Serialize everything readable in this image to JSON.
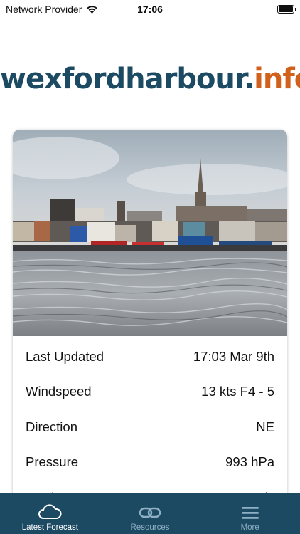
{
  "status": {
    "carrier": "Network Provider",
    "time": "17:06"
  },
  "logo": {
    "main": "wexfordharbour",
    "dot": ".",
    "ext": "info"
  },
  "weather": {
    "rows": [
      {
        "label": "Last Updated",
        "value": "17:03 Mar 9th"
      },
      {
        "label": "Windspeed",
        "value": "13 kts F4 - 5"
      },
      {
        "label": "Direction",
        "value": "NE"
      },
      {
        "label": "Pressure",
        "value": "993 hPa"
      },
      {
        "label": "Tend",
        "value": "...ady"
      }
    ]
  },
  "tabs": [
    {
      "label": "Latest Forecast",
      "icon": "cloud-icon",
      "active": true
    },
    {
      "label": "Resources",
      "icon": "link-icon",
      "active": false
    },
    {
      "label": "More",
      "icon": "menu-icon",
      "active": false
    }
  ],
  "colors": {
    "brand_navy": "#1c4a63",
    "brand_orange": "#d1601c"
  }
}
